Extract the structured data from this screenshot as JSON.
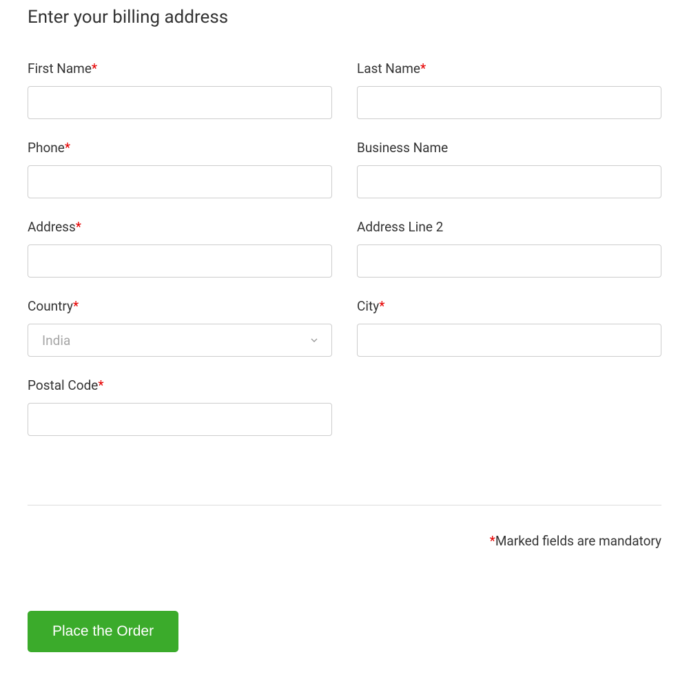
{
  "title": "Enter your billing address",
  "requiredMark": "*",
  "fields": {
    "firstName": {
      "label": "First Name",
      "required": true,
      "value": ""
    },
    "lastName": {
      "label": "Last Name",
      "required": true,
      "value": ""
    },
    "phone": {
      "label": "Phone",
      "required": true,
      "value": ""
    },
    "businessName": {
      "label": "Business Name",
      "required": false,
      "value": ""
    },
    "address": {
      "label": "Address",
      "required": true,
      "value": ""
    },
    "addressLine2": {
      "label": "Address Line 2",
      "required": false,
      "value": ""
    },
    "country": {
      "label": "Country",
      "required": true,
      "selected": "India"
    },
    "city": {
      "label": "City",
      "required": true,
      "value": ""
    },
    "postalCode": {
      "label": "Postal Code",
      "required": true,
      "value": ""
    }
  },
  "mandatoryNote": "Marked fields are mandatory",
  "submitLabel": "Place the Order"
}
